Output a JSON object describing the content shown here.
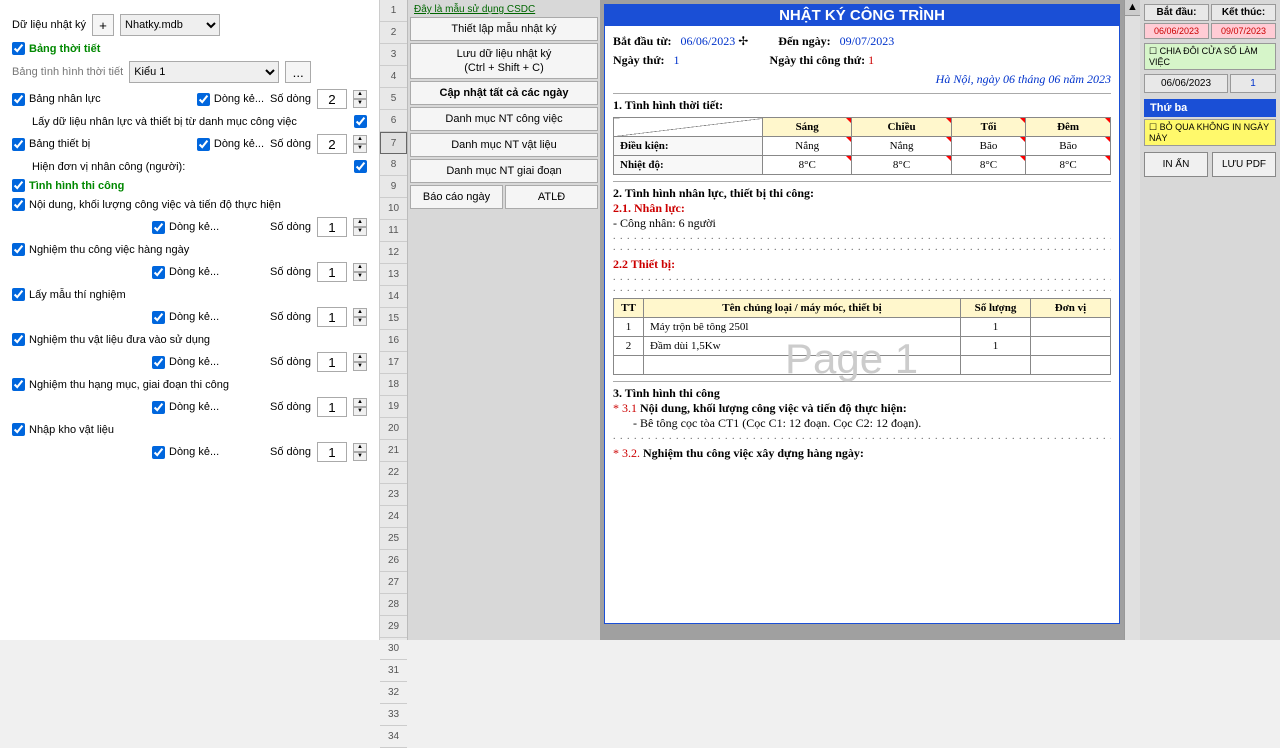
{
  "left": {
    "data_label": "Dữ liệu nhật ký",
    "add": "+",
    "db": "Nhatky.mdb",
    "sec_weather": "Bảng thời tiết",
    "weather_style_label": "Bảng tình hình thời tiết",
    "weather_style": "Kiểu 1",
    "dots": "...",
    "r_personnel": "Bảng nhân lực",
    "dong_ke": "Dòng kẻ...",
    "so_dong": "Số dòng",
    "v2": "2",
    "v1": "1",
    "get_data": "Lấy dữ liệu nhân lực và thiết bị từ danh mục công việc",
    "r_equip": "Bảng thiết bị",
    "show_unit": "Hiện đơn vị nhân công (người):",
    "sec_construction": "Tình hình thi công",
    "r_content": "Nội dung, khối lượng công việc và tiến độ thực hiện",
    "r_daily": "Nghiệm thu công việc hàng ngày",
    "r_sample": "Lấy mẫu thí nghiệm",
    "r_material": "Nghiệm thu vật liệu đưa vào sử dụng",
    "r_stage": "Nghiệm thu hạng mục, giai đoạn thi công",
    "r_warehouse": "Nhập kho vật liệu"
  },
  "mid": {
    "csdc": "Đây là mẫu sử dụng CSDC",
    "b_template": "Thiết lập mẫu nhật ký",
    "b_save": "Lưu dữ liệu nhật ký\n(Ctrl + Shift + C)",
    "b_update": "Cập nhật tất cả các ngày",
    "b_nt_work": "Danh mục NT công việc",
    "b_nt_mat": "Danh mục NT vật liệu",
    "b_nt_stage": "Danh mục NT giai đoạn",
    "b_report": "Báo cáo ngày",
    "b_atld": "ATLĐ",
    "rows": [
      "1",
      "2",
      "3",
      "4",
      "5",
      "6",
      "7",
      "8",
      "9",
      "10",
      "11",
      "12",
      "13",
      "14",
      "15",
      "16",
      "17",
      "18",
      "19",
      "20",
      "21",
      "22",
      "23",
      "24",
      "25",
      "26",
      "27",
      "28",
      "29",
      "30",
      "31",
      "32",
      "33",
      "34"
    ]
  },
  "doc": {
    "title": "NHẬT KÝ CÔNG TRÌNH",
    "start_l": "Bắt đầu từ:",
    "start_v": "06/06/2023",
    "end_l": "Đến ngày:",
    "end_v": "09/07/2023",
    "day_l": "Ngày thứ:",
    "day_v": "1",
    "cday_l": "Ngày thi công thứ:",
    "cday_v": "1",
    "loc": "Hà Nội, ngày 06 tháng 06 năm 2023",
    "s1": "1.   Tình hình thời tiết:",
    "th_morning": "Sáng",
    "th_noon": "Chiều",
    "th_evening": "Tối",
    "th_night": "Đêm",
    "row_cond": "Điều kiện:",
    "row_temp": "Nhiệt độ:",
    "nang": "Nắng",
    "bao": "Bão",
    "temp": "8°C",
    "s2": "2.   Tình hình nhân lực, thiết bị thi công:",
    "s21": "2.1. Nhân lực:",
    "worker": "- Công nhân: 6 người",
    "s22": "2.2 Thiết bị:",
    "watermark": "Page 1",
    "eth_tt": "TT",
    "eth_name": "Tên chủng loại / máy móc, thiết bị",
    "eth_qty": "Số lượng",
    "eth_unit": "Đơn vị",
    "e1n": "1",
    "e1name": "Máy trộn bê tông 250l",
    "e1q": "1",
    "e2n": "2",
    "e2name": "Đầm dùi 1,5Kw",
    "e2q": "1",
    "s3": "3.   Tình hình thi công",
    "s31p": "* 3.1",
    "s31": "Nội dung, khối lượng công việc và tiến độ thực hiện:",
    "s31c": "- Bê tông cọc tòa CT1 (Cọc C1: 12 đoạn. Cọc C2: 12 đoạn).",
    "s32p": "* 3.2.",
    "s32": "Nghiệm thu công việc xây dựng hàng ngày:"
  },
  "right": {
    "h_start": "Bắt đầu:",
    "h_end": "Kết thúc:",
    "d_start": "06/06/2023",
    "d_end": "09/07/2023",
    "split": "CHIA ĐÔI CỬA SỐ LÀM VIỆC",
    "sel_date": "06/06/2023",
    "sel_n": "1",
    "day": "Thứ ba",
    "skip": "BỎ QUA KHÔNG IN NGÀY NÀY",
    "print": "IN ẤN",
    "pdf": "LƯU PDF"
  }
}
